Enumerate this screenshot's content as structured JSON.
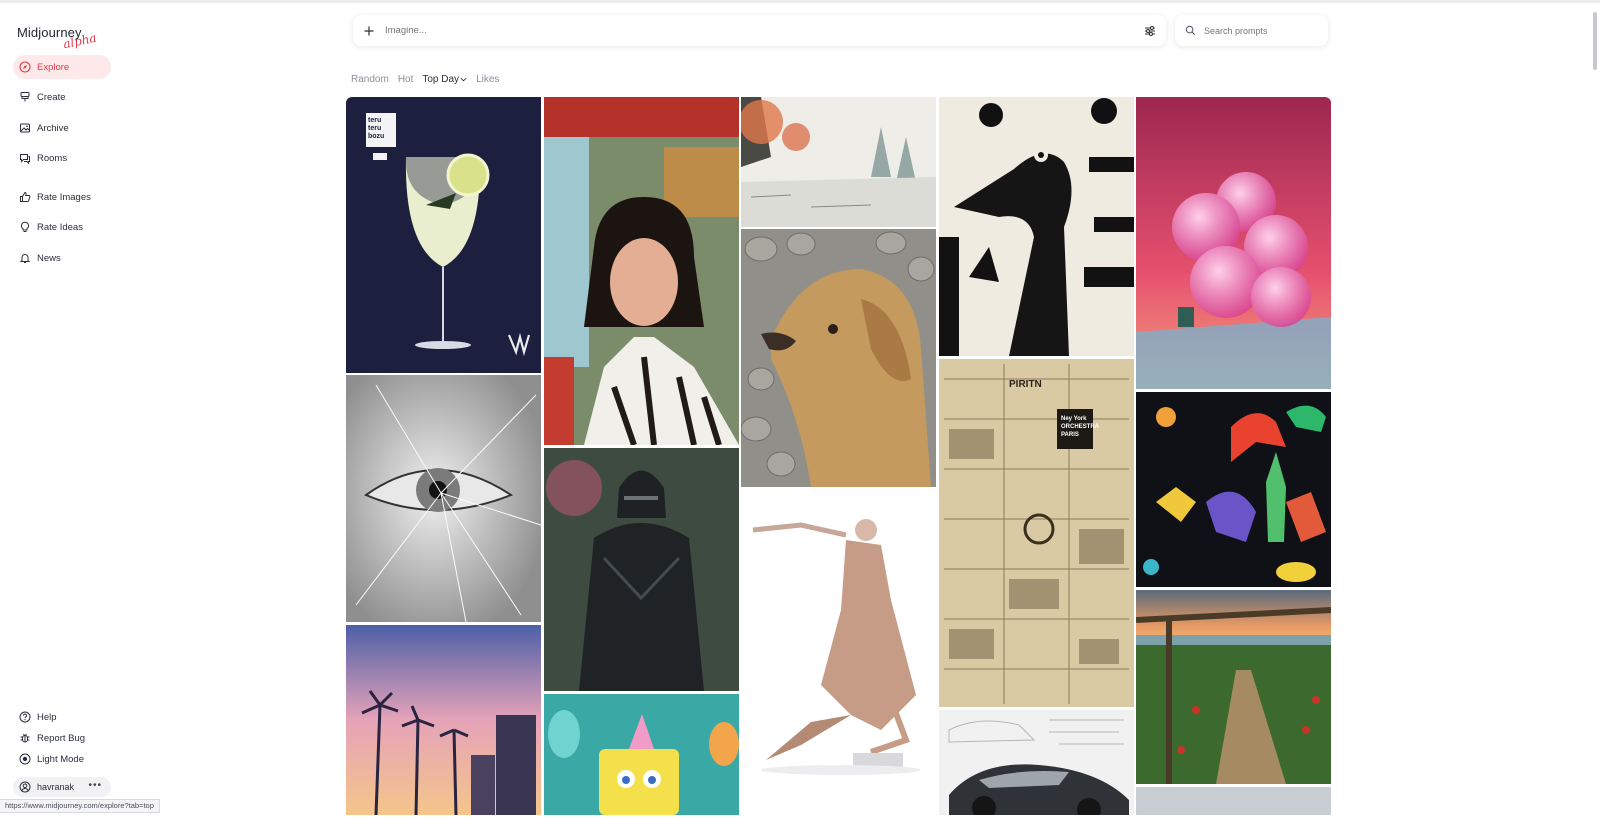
{
  "brand": {
    "name": "Midjourney",
    "tag": "alpha"
  },
  "nav": {
    "main": [
      {
        "label": "Explore",
        "icon": "compass-icon",
        "active": true
      },
      {
        "label": "Create",
        "icon": "brush-icon"
      },
      {
        "label": "Archive",
        "icon": "image-icon"
      },
      {
        "label": "Rooms",
        "icon": "chat-icon"
      },
      {
        "label": "Rate Images",
        "icon": "thumbs-up-icon"
      },
      {
        "label": "Rate Ideas",
        "icon": "lightbulb-icon"
      },
      {
        "label": "News",
        "icon": "bell-icon"
      }
    ],
    "bottom": [
      {
        "label": "Help",
        "icon": "help-icon"
      },
      {
        "label": "Report Bug",
        "icon": "bug-icon"
      },
      {
        "label": "Light Mode",
        "icon": "sun-icon"
      }
    ]
  },
  "user": {
    "name": "havranak",
    "more": "•••"
  },
  "status_url": "https://www.midjourney.com/explore?tab=top",
  "imagine": {
    "placeholder": "Imagine..."
  },
  "search": {
    "placeholder": "Search prompts"
  },
  "tabs": [
    {
      "label": "Random",
      "active": false
    },
    {
      "label": "Hot",
      "active": false
    },
    {
      "label": "Top Day",
      "active": true
    },
    {
      "label": "Likes",
      "active": false
    }
  ],
  "tiles": {
    "poster_brand": "teru teru bozu",
    "newspaper_headline": "PIRITN",
    "newspaper_sub": "Ney York ORCHESTRA PARIS",
    "poster_corner": "M"
  }
}
